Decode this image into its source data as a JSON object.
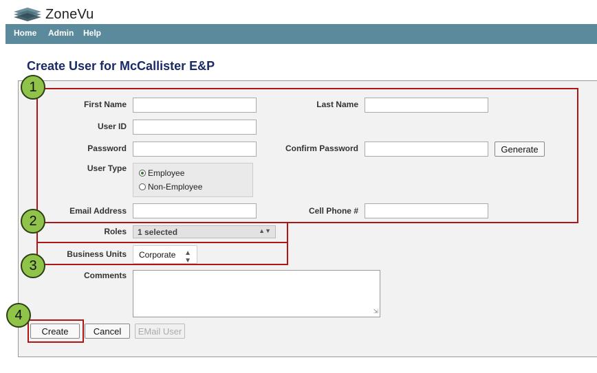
{
  "app": {
    "logo_text": "ZoneVu"
  },
  "nav": {
    "items": [
      "Home",
      "Admin",
      "Help"
    ]
  },
  "page": {
    "title": "Create User for McCallister E&P"
  },
  "form": {
    "labels": {
      "first_name": "First Name",
      "last_name": "Last Name",
      "user_id": "User ID",
      "password": "Password",
      "confirm_password": "Confirm Password",
      "user_type": "User Type",
      "email": "Email Address",
      "cell_phone": "Cell Phone #",
      "roles": "Roles",
      "business_units": "Business Units",
      "comments": "Comments"
    },
    "values": {
      "first_name": "",
      "last_name": "",
      "user_id": "",
      "password": "",
      "confirm_password": "",
      "email": "",
      "cell_phone": "",
      "comments": ""
    },
    "user_type_options": [
      {
        "label": "Employee",
        "selected": true
      },
      {
        "label": "Non-Employee",
        "selected": false
      }
    ],
    "roles_value": "1 selected",
    "business_unit_value": "Corporate",
    "buttons": {
      "generate": "Generate",
      "create": "Create",
      "cancel": "Cancel",
      "email_user": "EMail User"
    }
  },
  "callouts": [
    "1",
    "2",
    "3",
    "4"
  ],
  "colors": {
    "nav_bg": "#5b8a9c",
    "title": "#1a2a66",
    "highlight": "#b01515",
    "badge": "#8fc34a"
  }
}
